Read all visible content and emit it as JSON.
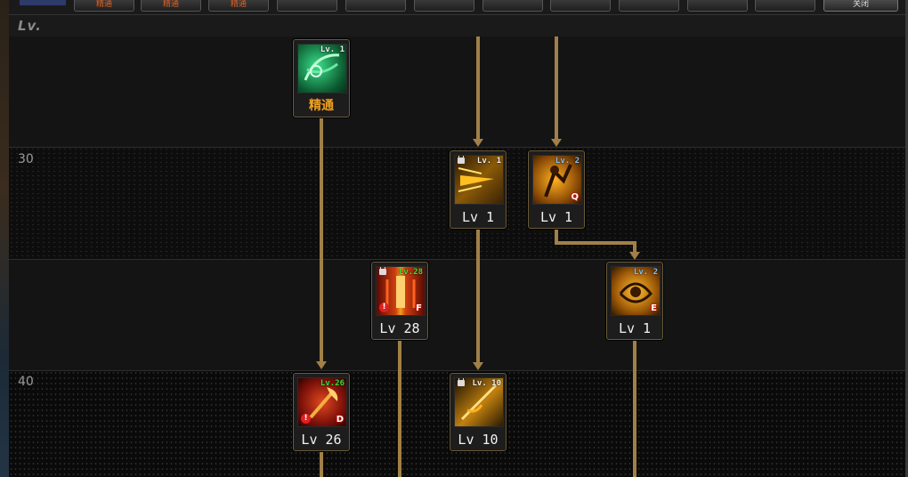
{
  "header": {
    "level_label": "Lv."
  },
  "tabs": [
    {
      "label": "精通"
    },
    {
      "label": "精通"
    },
    {
      "label": "精通"
    },
    {
      "label": ""
    },
    {
      "label": ""
    },
    {
      "label": ""
    },
    {
      "label": ""
    },
    {
      "label": ""
    },
    {
      "label": ""
    },
    {
      "label": ""
    },
    {
      "label": ""
    }
  ],
  "exit_button": {
    "label": "关闭"
  },
  "level_markers": [
    "30",
    "40"
  ],
  "nodes": [
    {
      "id": "mastery",
      "badge": "Lv. 1",
      "level_text": "精通",
      "locked": false,
      "hotkey": "",
      "color": "#22a060"
    },
    {
      "id": "dash-strike",
      "badge": "Lv. 1",
      "level_text": "Lv 1",
      "locked": true,
      "hotkey": "",
      "color": "#d89a10"
    },
    {
      "id": "rising-slash",
      "badge": "Lv. 2",
      "level_text": "Lv 1",
      "locked": false,
      "hotkey": "Q",
      "color": "#d89a10"
    },
    {
      "id": "flame-pillar",
      "badge": "Lv.28",
      "level_text": "Lv 28",
      "locked": true,
      "hotkey": "F",
      "color": "#c03018"
    },
    {
      "id": "whirl-blade",
      "badge": "Lv. 2",
      "level_text": "Lv 1",
      "locked": false,
      "hotkey": "E",
      "color": "#d89a10"
    },
    {
      "id": "blood-axe",
      "badge": "Lv.26",
      "level_text": "Lv 26",
      "locked": false,
      "hotkey": "D",
      "color": "#b02818"
    },
    {
      "id": "dragon-spear",
      "badge": "Lv. 10",
      "level_text": "Lv 10",
      "locked": true,
      "hotkey": "",
      "color": "#d89a10"
    }
  ]
}
